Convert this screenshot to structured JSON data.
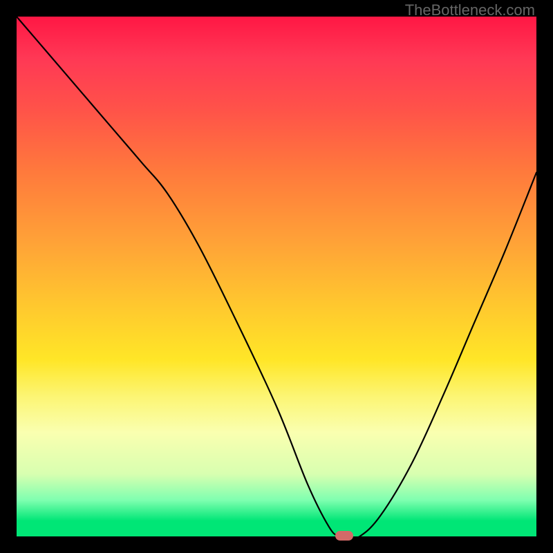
{
  "attribution": "TheBottleneck.com",
  "chart_data": {
    "type": "line",
    "title": "",
    "xlabel": "",
    "ylabel": "",
    "xlim": [
      0,
      100
    ],
    "ylim": [
      0,
      100
    ],
    "x": [
      0,
      6,
      12,
      18,
      24,
      29,
      35,
      42,
      50,
      56,
      60,
      62,
      64,
      66,
      70,
      76,
      82,
      88,
      94,
      100
    ],
    "values": [
      100,
      93,
      86,
      79,
      72,
      66,
      56,
      42,
      25,
      10,
      2,
      0,
      0,
      0,
      4,
      14,
      27,
      41,
      55,
      70
    ],
    "marker": {
      "x": 63,
      "y": 0,
      "color": "#d36a68"
    },
    "background_gradient": {
      "top": "#ff1744",
      "mid_upper": "#ffa437",
      "mid": "#ffe627",
      "mid_lower": "#faffb0",
      "bottom": "#00e676"
    }
  }
}
